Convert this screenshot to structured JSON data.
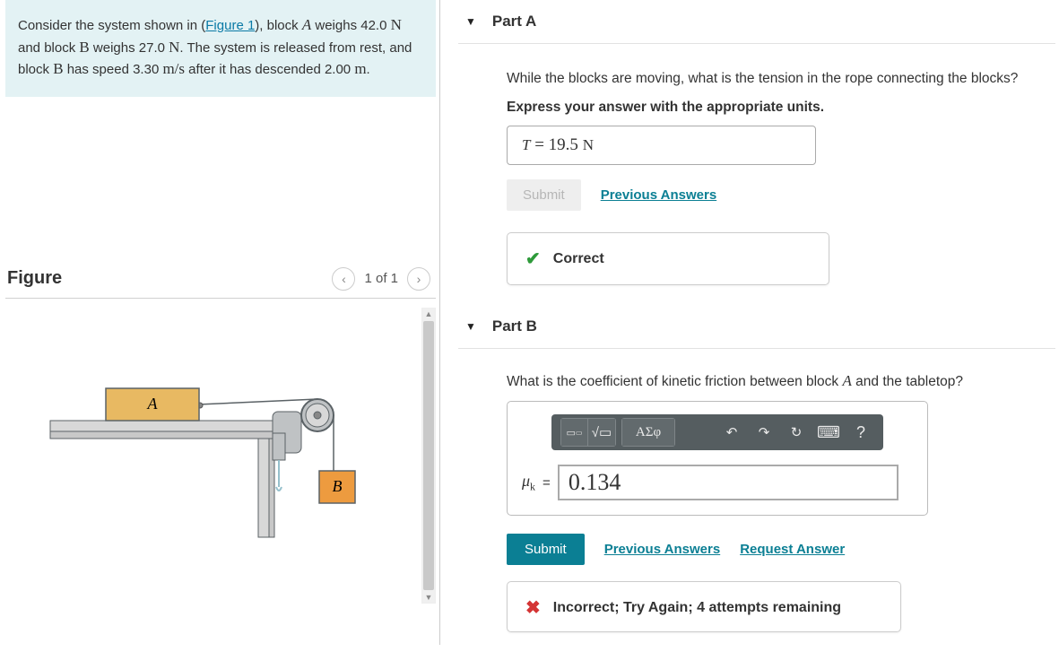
{
  "problem": {
    "pre": "Consider the system shown in (",
    "link": "Figure 1",
    "post_link": "), block ",
    "A": "A",
    "t1": " weighs 42.0 ",
    "N1": "N",
    "t2": " and block ",
    "B": "B",
    "t3": " weighs 27.0 ",
    "N2": "N",
    "t4": ". The system is released from rest, and block ",
    "B2": "B",
    "t5": " has speed 3.30 ",
    "ms": "m/s",
    "t6": " after it has descended 2.00 ",
    "mUnit": "m",
    "t7": "."
  },
  "figure": {
    "title": "Figure",
    "counter": "1 of 1",
    "labelA": "A",
    "labelB": "B"
  },
  "partA": {
    "title": "Part A",
    "question": "While the blocks are moving, what is the tension in the rope connecting the blocks?",
    "instruction": "Express your answer with the appropriate units.",
    "answer_var": "T",
    "answer_eq": " =  19.5 ",
    "answer_unit": "N",
    "submit": "Submit",
    "prev": "Previous Answers",
    "feedback": "Correct"
  },
  "partB": {
    "title": "Part B",
    "q_pre": "What is the coefficient of kinetic friction between block ",
    "q_A": "A",
    "q_post": " and the tabletop?",
    "toolbar_greek": "ΑΣφ",
    "var_label": "μk",
    "eq": " = ",
    "value": "0.134",
    "submit": "Submit",
    "prev": "Previous Answers",
    "req": "Request Answer",
    "feedback": "Incorrect; Try Again; 4 attempts remaining"
  }
}
